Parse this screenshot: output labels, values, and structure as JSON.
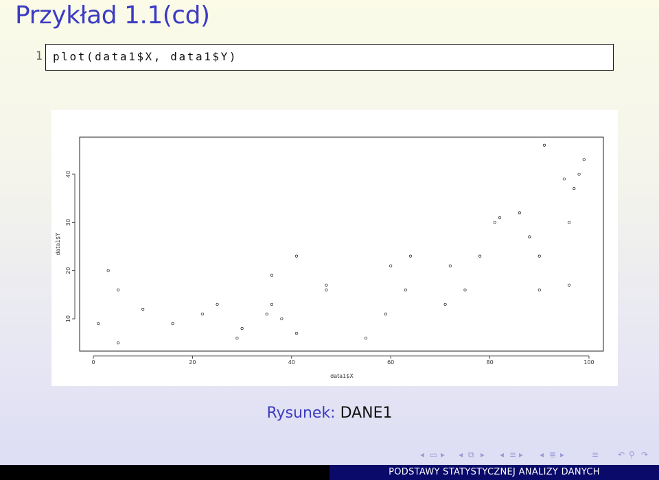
{
  "frame": {
    "title": "Przykład 1.1(cd)"
  },
  "code": {
    "line_number": "1",
    "text": "plot(data1$X, data1$Y)"
  },
  "caption": {
    "label": "Rysunek:",
    "text": "DANE1"
  },
  "footer": {
    "left_text": "",
    "right_text": "PODSTAWY STATYSTYCZNEJ ANALIZY DANYCH"
  },
  "nav_icons": [
    "prev-frame-icon",
    "frame-icon",
    "next-frame-icon",
    "prev-subsection-icon",
    "subsection-icon",
    "next-subsection-icon",
    "prev-section-icon",
    "section-icon",
    "next-section-icon",
    "prev-slide-icon",
    "slide-icon",
    "next-slide-icon",
    "align-icon",
    "back-icon",
    "search-icon",
    "forward-icon"
  ],
  "chart_data": {
    "type": "scatter",
    "xlabel": "data1$X",
    "ylabel": "data1$Y",
    "xlim": [
      0,
      100
    ],
    "ylim": [
      4,
      48
    ],
    "x_ticks": [
      "0",
      "20",
      "40",
      "60",
      "80",
      "100"
    ],
    "y_ticks": [
      "10",
      "20",
      "30",
      "40"
    ],
    "x": [
      1,
      3,
      5,
      5,
      10,
      16,
      22,
      25,
      29,
      30,
      35,
      36,
      36,
      38,
      41,
      41,
      47,
      47,
      55,
      59,
      60,
      63,
      64,
      71,
      72,
      75,
      78,
      81,
      82,
      86,
      88,
      90,
      90,
      91,
      95,
      96,
      96,
      97,
      98,
      99
    ],
    "y": [
      9,
      20,
      16,
      5,
      12,
      9,
      11,
      13,
      6,
      8,
      11,
      19,
      13,
      10,
      23,
      7,
      16,
      17,
      6,
      11,
      21,
      16,
      23,
      13,
      21,
      16,
      23,
      30,
      31,
      32,
      27,
      23,
      16,
      46,
      39,
      30,
      17,
      37,
      40,
      43
    ]
  }
}
